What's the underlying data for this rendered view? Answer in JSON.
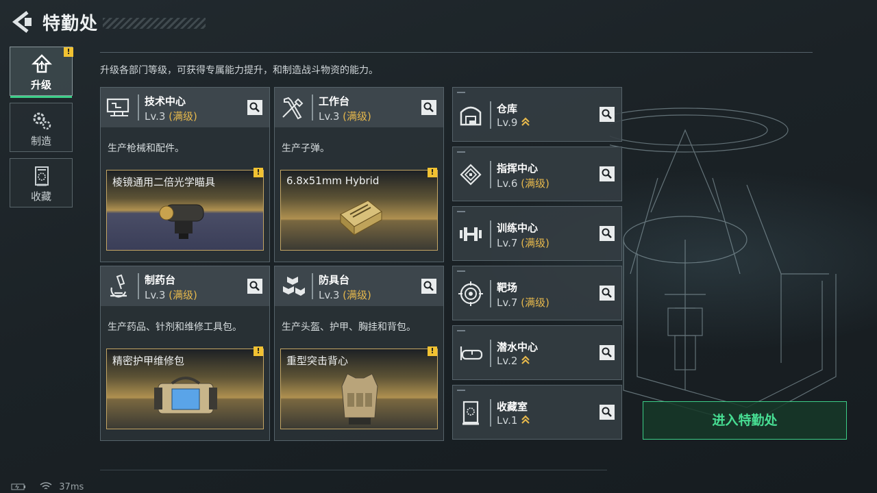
{
  "header": {
    "title": "特勤处",
    "back_icon": "back-arrow-icon"
  },
  "sidebar": [
    {
      "label": "升级",
      "icon": "upgrade-icon",
      "active": true,
      "warn": "!"
    },
    {
      "label": "制造",
      "icon": "gears-icon",
      "active": false
    },
    {
      "label": "收藏",
      "icon": "collection-icon",
      "active": false
    }
  ],
  "description": "升级各部门等级，可获得专属能力提升，和制造战斗物资的能力。",
  "cards": [
    {
      "name": "技术中心",
      "level": "Lv.3",
      "max": "(满级)",
      "produces": "生产枪械和配件。",
      "item": "棱镜通用二倍光学瞄具",
      "warn": "!",
      "icon": "tech-center-icon"
    },
    {
      "name": "工作台",
      "level": "Lv.3",
      "max": "(满级)",
      "produces": "生产子弹。",
      "item": "6.8x51mm Hybrid",
      "warn": "!",
      "icon": "workbench-icon"
    },
    {
      "name": "制药台",
      "level": "Lv.3",
      "max": "(满级)",
      "produces": "生产药品、针剂和维修工具包。",
      "item": "精密护甲维修包",
      "warn": "!",
      "icon": "microscope-icon"
    },
    {
      "name": "防具台",
      "level": "Lv.3",
      "max": "(满级)",
      "produces": "生产头盔、护甲、胸挂和背包。",
      "item": "重型突击背心",
      "warn": "!",
      "icon": "armor-bench-icon"
    }
  ],
  "facilities": [
    {
      "name": "仓库",
      "level": "Lv.9",
      "max": "",
      "icon": "warehouse-icon",
      "upgradable": true
    },
    {
      "name": "指挥中心",
      "level": "Lv.6",
      "max": "(满级)",
      "icon": "chip-icon",
      "upgradable": false
    },
    {
      "name": "训练中心",
      "level": "Lv.7",
      "max": "(满级)",
      "icon": "dumbbell-icon",
      "upgradable": false
    },
    {
      "name": "靶场",
      "level": "Lv.7",
      "max": "(满级)",
      "icon": "target-icon",
      "upgradable": false
    },
    {
      "name": "潜水中心",
      "level": "Lv.2",
      "max": "",
      "icon": "diving-mask-icon",
      "upgradable": true
    },
    {
      "name": "收藏室",
      "level": "Lv.1",
      "max": "",
      "icon": "collection-room-icon",
      "upgradable": true
    }
  ],
  "enter_button": "进入特勤处",
  "status": {
    "ping": "37ms"
  },
  "colors": {
    "accent": "#3ccf88",
    "max_level": "#e6b84c",
    "warning": "#f1c232"
  }
}
